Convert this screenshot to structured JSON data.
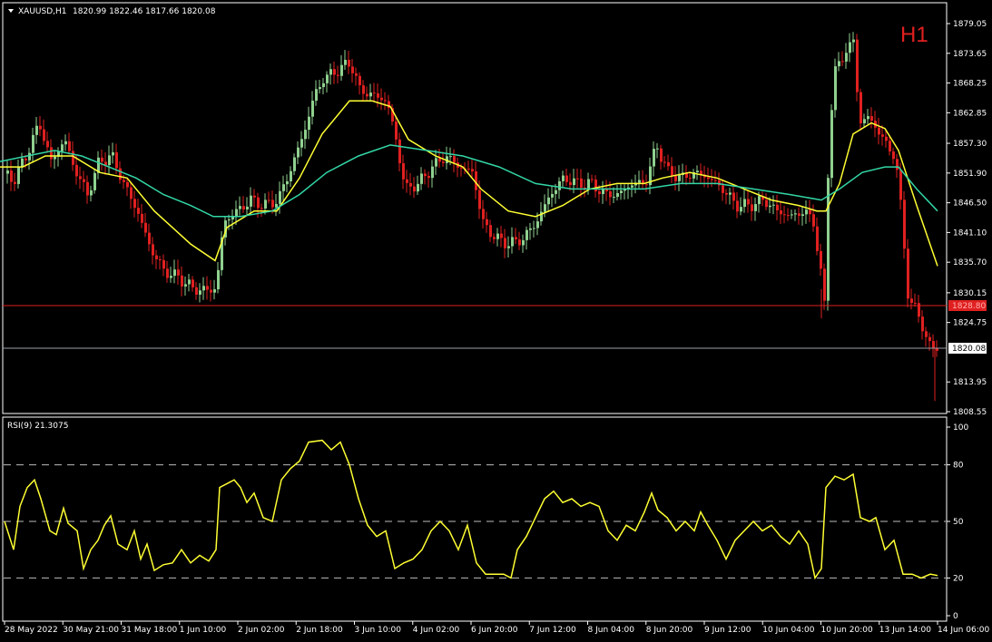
{
  "header": {
    "symbol": "XAUUSD,H1",
    "ohlc": "1820.99 1822.46 1817.66 1820.08",
    "timeframe_badge": "H1"
  },
  "price_axis": {
    "labels": [
      "1879.05",
      "1873.65",
      "1868.25",
      "1862.85",
      "1857.30",
      "1851.90",
      "1846.50",
      "1841.10",
      "1835.70",
      "1830.15",
      "1824.75",
      "1813.95",
      "1808.55"
    ],
    "marked_level": "1828.80",
    "current_price": "1820.08"
  },
  "rsi_panel": {
    "title": "RSI(9) 21.3075",
    "labels": [
      "100",
      "80",
      "50",
      "20",
      "0"
    ]
  },
  "time_axis": {
    "labels": [
      "28 May 2022",
      "30 May 21:00",
      "31 May 18:00",
      "1 Jun 10:00",
      "2 Jun 02:00",
      "2 Jun 18:00",
      "3 Jun 10:00",
      "4 Jun 02:00",
      "6 Jun 20:00",
      "7 Jun 12:00",
      "8 Jun 04:00",
      "8 Jun 20:00",
      "9 Jun 12:00",
      "10 Jun 04:00",
      "10 Jun 20:00",
      "13 Jun 14:00",
      "14 Jun 06:00"
    ]
  },
  "colors": {
    "background": "#000000",
    "bull_candle": "#8fd08f",
    "bear_candle": "#e02020",
    "ma_fast": "#ffff33",
    "ma_slow": "#33d6a6",
    "level_line": "#e02020",
    "price_line": "#9aa0a8",
    "rsi_line": "#ffff33",
    "badge": "#e02020"
  },
  "chart_data": [
    {
      "type": "candlestick",
      "title": "XAUUSD,H1",
      "ylim": [
        1808.55,
        1879.05
      ],
      "close_path": [
        [
          0,
          1852.5
        ],
        [
          14,
          1850.5
        ],
        [
          30,
          1856
        ],
        [
          42,
          1861
        ],
        [
          55,
          1854
        ],
        [
          70,
          1858
        ],
        [
          80,
          1853
        ],
        [
          95,
          1848
        ],
        [
          108,
          1854
        ],
        [
          122,
          1855
        ],
        [
          135,
          1850
        ],
        [
          150,
          1845
        ],
        [
          165,
          1838
        ],
        [
          180,
          1834
        ],
        [
          195,
          1833
        ],
        [
          210,
          1831
        ],
        [
          225,
          1830.5
        ],
        [
          237,
          1831
        ],
        [
          245,
          1843
        ],
        [
          260,
          1845
        ],
        [
          275,
          1847
        ],
        [
          290,
          1846
        ],
        [
          305,
          1847
        ],
        [
          320,
          1853
        ],
        [
          335,
          1860
        ],
        [
          345,
          1866
        ],
        [
          355,
          1869
        ],
        [
          365,
          1870
        ],
        [
          375,
          1871
        ],
        [
          385,
          1872
        ],
        [
          395,
          1867
        ],
        [
          410,
          1866
        ],
        [
          425,
          1865
        ],
        [
          435,
          1858
        ],
        [
          445,
          1849
        ],
        [
          460,
          1850
        ],
        [
          475,
          1853
        ],
        [
          490,
          1855
        ],
        [
          505,
          1853
        ],
        [
          520,
          1852
        ],
        [
          530,
          1843
        ],
        [
          545,
          1840
        ],
        [
          560,
          1839
        ],
        [
          575,
          1840
        ],
        [
          590,
          1843
        ],
        [
          605,
          1848
        ],
        [
          620,
          1851
        ],
        [
          635,
          1850
        ],
        [
          650,
          1850
        ],
        [
          665,
          1848
        ],
        [
          680,
          1848
        ],
        [
          695,
          1850
        ],
        [
          710,
          1850
        ],
        [
          722,
          1857
        ],
        [
          735,
          1852
        ],
        [
          750,
          1851
        ],
        [
          765,
          1852
        ],
        [
          780,
          1851
        ],
        [
          795,
          1849
        ],
        [
          810,
          1846
        ],
        [
          825,
          1846
        ],
        [
          840,
          1847
        ],
        [
          855,
          1845
        ],
        [
          870,
          1844
        ],
        [
          885,
          1845
        ],
        [
          895,
          1843
        ],
        [
          902,
          1835
        ],
        [
          907,
          1828
        ],
        [
          912,
          1858
        ],
        [
          918,
          1870
        ],
        [
          930,
          1874
        ],
        [
          940,
          1876
        ],
        [
          945,
          1861
        ],
        [
          955,
          1862
        ],
        [
          965,
          1860
        ],
        [
          975,
          1857
        ],
        [
          985,
          1855
        ],
        [
          993,
          1843
        ],
        [
          1000,
          1828
        ],
        [
          1010,
          1827
        ],
        [
          1020,
          1821
        ],
        [
          1030,
          1820.08
        ]
      ],
      "low_marks": [
        [
          1030,
          1810.5
        ],
        [
          905,
          1825.5
        ]
      ]
    },
    {
      "type": "line",
      "series": [
        {
          "values": [
            [
              0,
              1853
            ],
            [
              25,
              1853
            ],
            [
              50,
              1855
            ],
            [
              80,
              1855
            ],
            [
              110,
              1852
            ],
            [
              140,
              1851
            ],
            [
              170,
              1845
            ],
            [
              210,
              1839
            ],
            [
              237,
              1836
            ],
            [
              250,
              1842
            ],
            [
              280,
              1845
            ],
            [
              305,
              1845
            ],
            [
              330,
              1851
            ],
            [
              355,
              1859
            ],
            [
              385,
              1865
            ],
            [
              410,
              1865
            ],
            [
              430,
              1864
            ],
            [
              450,
              1858
            ],
            [
              480,
              1855
            ],
            [
              510,
              1853
            ],
            [
              530,
              1849
            ],
            [
              560,
              1845
            ],
            [
              590,
              1844
            ],
            [
              620,
              1846
            ],
            [
              650,
              1849
            ],
            [
              680,
              1850
            ],
            [
              710,
              1850
            ],
            [
              730,
              1851
            ],
            [
              760,
              1852
            ],
            [
              790,
              1851
            ],
            [
              820,
              1849
            ],
            [
              850,
              1847
            ],
            [
              880,
              1846
            ],
            [
              900,
              1845
            ],
            [
              910,
              1845
            ],
            [
              925,
              1850
            ],
            [
              940,
              1859
            ],
            [
              960,
              1861
            ],
            [
              975,
              1860
            ],
            [
              990,
              1856
            ],
            [
              1010,
              1846
            ],
            [
              1033,
              1835
            ]
          ]
        },
        {
          "values": [
            [
              0,
              1854
            ],
            [
              30,
              1855
            ],
            [
              60,
              1856
            ],
            [
              90,
              1855
            ],
            [
              120,
              1853
            ],
            [
              150,
              1851
            ],
            [
              180,
              1848
            ],
            [
              210,
              1846
            ],
            [
              235,
              1844
            ],
            [
              265,
              1844
            ],
            [
              300,
              1845
            ],
            [
              330,
              1848
            ],
            [
              360,
              1852
            ],
            [
              395,
              1855
            ],
            [
              430,
              1857
            ],
            [
              470,
              1856
            ],
            [
              510,
              1855
            ],
            [
              550,
              1853
            ],
            [
              590,
              1850
            ],
            [
              630,
              1849
            ],
            [
              670,
              1849
            ],
            [
              710,
              1849
            ],
            [
              750,
              1850
            ],
            [
              790,
              1850
            ],
            [
              830,
              1849
            ],
            [
              870,
              1848
            ],
            [
              905,
              1847
            ],
            [
              925,
              1849
            ],
            [
              950,
              1852
            ],
            [
              975,
              1853
            ],
            [
              990,
              1853
            ],
            [
              1010,
              1849
            ],
            [
              1033,
              1845
            ]
          ]
        }
      ]
    },
    {
      "type": "line",
      "title": "RSI(9) 21.3075",
      "ylim": [
        0,
        100
      ],
      "series": [
        {
          "values": [
            [
              5,
              50
            ],
            [
              15,
              35
            ],
            [
              22,
              58
            ],
            [
              30,
              68
            ],
            [
              38,
              72
            ],
            [
              45,
              62
            ],
            [
              55,
              45
            ],
            [
              62,
              43
            ],
            [
              70,
              57
            ],
            [
              75,
              49
            ],
            [
              85,
              45
            ],
            [
              92,
              25
            ],
            [
              100,
              35
            ],
            [
              108,
              40
            ],
            [
              115,
              48
            ],
            [
              122,
              53
            ],
            [
              130,
              38
            ],
            [
              140,
              35
            ],
            [
              148,
              45
            ],
            [
              155,
              30
            ],
            [
              162,
              38
            ],
            [
              170,
              24
            ],
            [
              180,
              27
            ],
            [
              190,
              28
            ],
            [
              200,
              35
            ],
            [
              210,
              28
            ],
            [
              220,
              32
            ],
            [
              230,
              29
            ],
            [
              238,
              35
            ],
            [
              242,
              68
            ],
            [
              250,
              70
            ],
            [
              258,
              72
            ],
            [
              265,
              68
            ],
            [
              272,
              60
            ],
            [
              280,
              65
            ],
            [
              290,
              52
            ],
            [
              300,
              50
            ],
            [
              310,
              72
            ],
            [
              320,
              78
            ],
            [
              330,
              82
            ],
            [
              340,
              92
            ],
            [
              355,
              93
            ],
            [
              365,
              88
            ],
            [
              375,
              92
            ],
            [
              385,
              80
            ],
            [
              395,
              62
            ],
            [
              405,
              48
            ],
            [
              415,
              42
            ],
            [
              425,
              45
            ],
            [
              435,
              25
            ],
            [
              445,
              28
            ],
            [
              455,
              30
            ],
            [
              465,
              35
            ],
            [
              475,
              45
            ],
            [
              485,
              50
            ],
            [
              495,
              45
            ],
            [
              505,
              35
            ],
            [
              515,
              48
            ],
            [
              525,
              28
            ],
            [
              535,
              22
            ],
            [
              545,
              22
            ],
            [
              555,
              22
            ],
            [
              563,
              20
            ],
            [
              570,
              35
            ],
            [
              580,
              42
            ],
            [
              590,
              52
            ],
            [
              600,
              62
            ],
            [
              610,
              66
            ],
            [
              620,
              60
            ],
            [
              630,
              62
            ],
            [
              640,
              58
            ],
            [
              650,
              60
            ],
            [
              660,
              58
            ],
            [
              670,
              45
            ],
            [
              680,
              40
            ],
            [
              690,
              48
            ],
            [
              700,
              45
            ],
            [
              710,
              55
            ],
            [
              718,
              65
            ],
            [
              725,
              56
            ],
            [
              735,
              52
            ],
            [
              745,
              45
            ],
            [
              755,
              50
            ],
            [
              765,
              45
            ],
            [
              772,
              55
            ],
            [
              780,
              48
            ],
            [
              790,
              40
            ],
            [
              800,
              30
            ],
            [
              810,
              40
            ],
            [
              820,
              45
            ],
            [
              830,
              50
            ],
            [
              840,
              45
            ],
            [
              850,
              48
            ],
            [
              860,
              42
            ],
            [
              870,
              38
            ],
            [
              880,
              45
            ],
            [
              890,
              38
            ],
            [
              898,
              20
            ],
            [
              905,
              25
            ],
            [
              910,
              68
            ],
            [
              920,
              74
            ],
            [
              930,
              72
            ],
            [
              940,
              75
            ],
            [
              948,
              52
            ],
            [
              958,
              50
            ],
            [
              965,
              52
            ],
            [
              975,
              35
            ],
            [
              985,
              40
            ],
            [
              995,
              22
            ],
            [
              1005,
              22
            ],
            [
              1015,
              20
            ],
            [
              1025,
              22
            ],
            [
              1033,
              21.3
            ]
          ]
        }
      ]
    }
  ]
}
